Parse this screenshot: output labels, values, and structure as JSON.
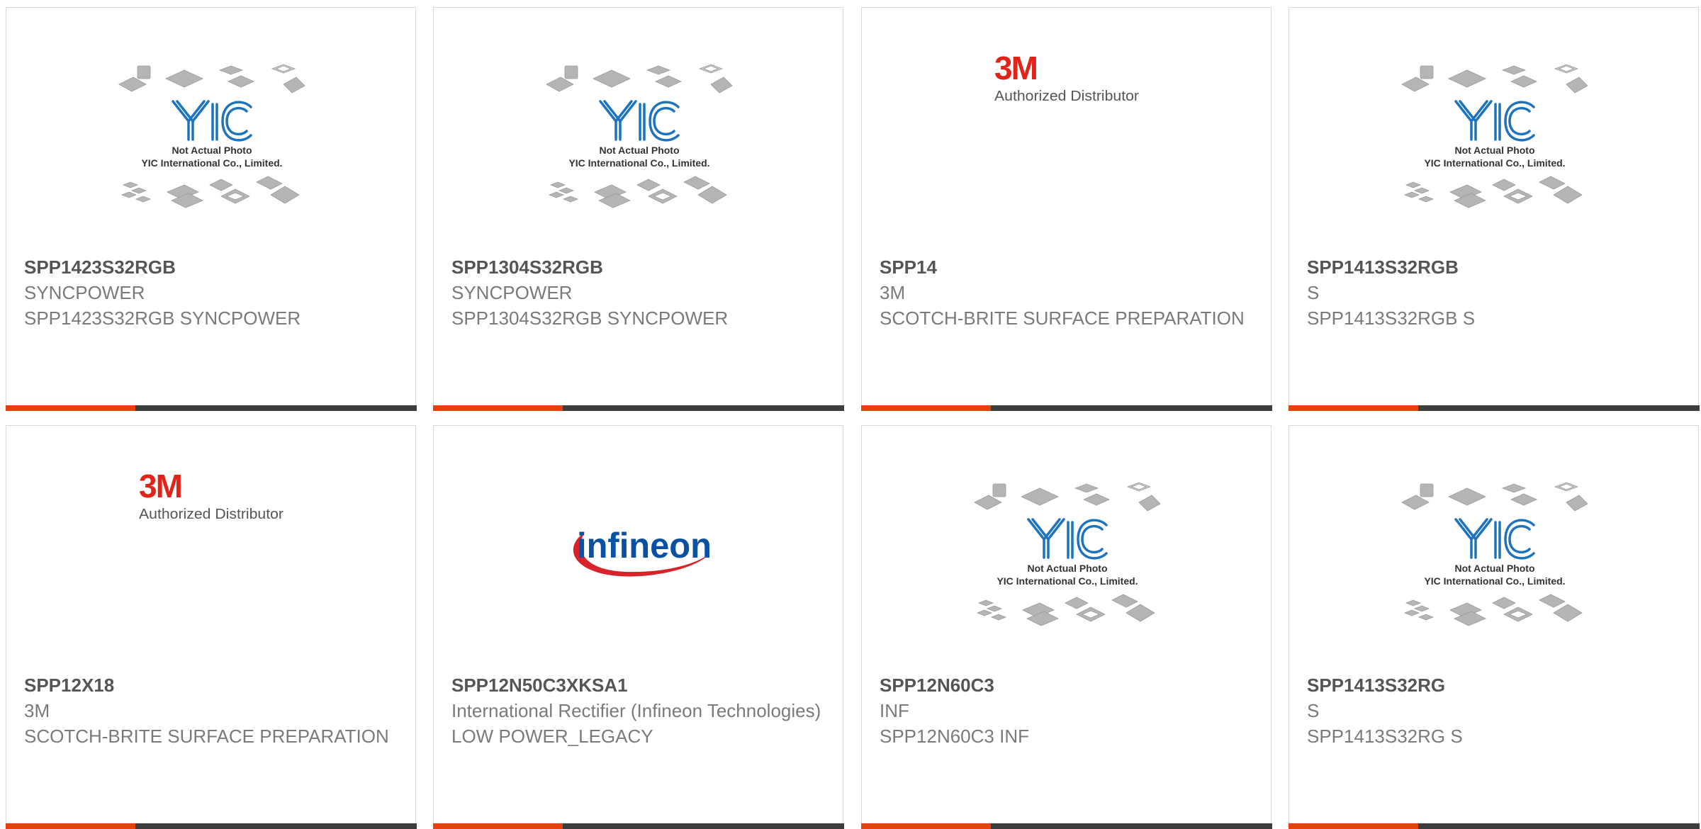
{
  "colors": {
    "accent": "#e8400c",
    "bar": "#3d3d3d",
    "border": "#d9d9d9",
    "part_number": "#555555",
    "text": "#7a7a7a",
    "yic_blue": "#1e73be",
    "brand_3m": "#e2231a",
    "infineon_blue": "#0a52a1",
    "infineon_red": "#d8232a"
  },
  "logo_text": {
    "yic_mark": "YIC",
    "yic_line1": "Not Actual Photo",
    "yic_line2": "YIC International Co., Limited.",
    "m3_mark": "3M",
    "m3_sub": "Authorized Distributor",
    "infineon": "infineon"
  },
  "products": [
    {
      "part_number": "SPP1423S32RGB",
      "manufacturer": "SYNCPOWER",
      "description": "SPP1423S32RGB SYNCPOWER",
      "image": "yic-placeholder"
    },
    {
      "part_number": "SPP1304S32RGB",
      "manufacturer": "SYNCPOWER",
      "description": "SPP1304S32RGB SYNCPOWER",
      "image": "yic-placeholder"
    },
    {
      "part_number": "SPP14",
      "manufacturer": "3M",
      "description": "SCOTCH-BRITE SURFACE PREPARATION",
      "image": "3m-logo"
    },
    {
      "part_number": "SPP1413S32RGB",
      "manufacturer": "S",
      "description": "SPP1413S32RGB S",
      "image": "yic-placeholder"
    },
    {
      "part_number": "SPP12X18",
      "manufacturer": "3M",
      "description": "SCOTCH-BRITE SURFACE PREPARATION",
      "image": "3m-logo"
    },
    {
      "part_number": "SPP12N50C3XKSA1",
      "manufacturer": "International Rectifier (Infineon Technologies)",
      "description": "LOW POWER_LEGACY",
      "image": "infineon-logo"
    },
    {
      "part_number": "SPP12N60C3",
      "manufacturer": "INF",
      "description": "SPP12N60C3 INF",
      "image": "yic-placeholder"
    },
    {
      "part_number": "SPP1413S32RG",
      "manufacturer": "S",
      "description": "SPP1413S32RG S",
      "image": "yic-placeholder"
    }
  ]
}
